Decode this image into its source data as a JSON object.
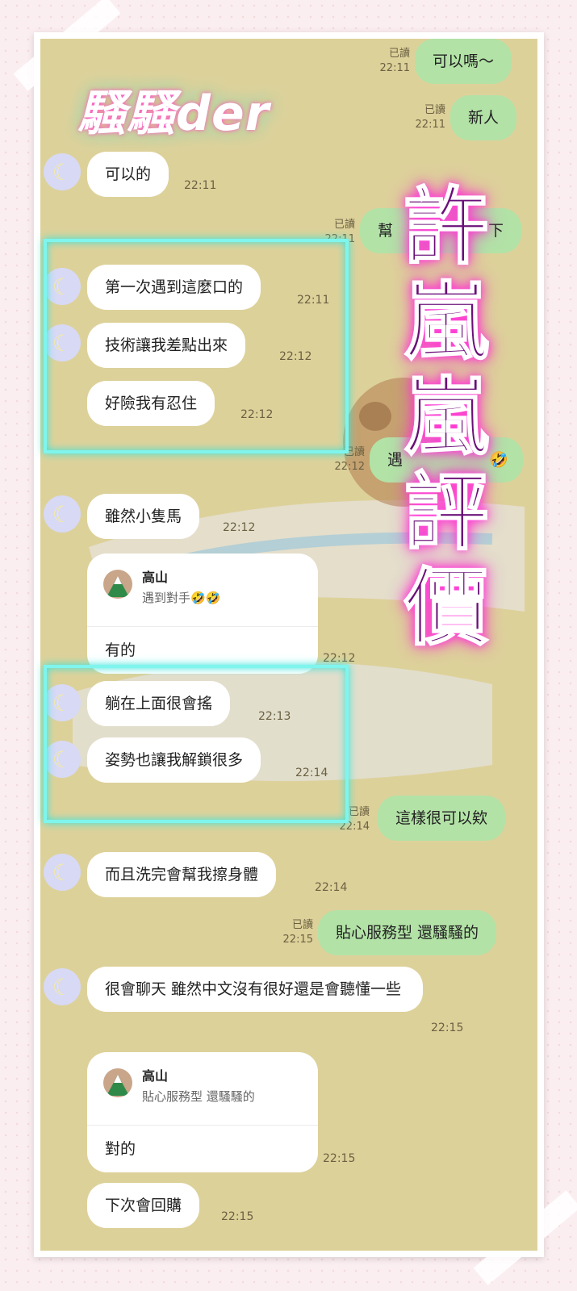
{
  "logo": "騷騷der",
  "title_chars": [
    "許",
    "嵐",
    "嵐",
    "評",
    "價"
  ],
  "colors": {
    "chat_bg": "#ddd19a",
    "my_bubble": "#b2e2a6",
    "glow": "#7ff5ee",
    "title": "#6a0f78"
  },
  "avatar_icon": "moon-icon",
  "messages": {
    "m1": {
      "text": "可以嗎～",
      "read": "已讀",
      "time": "22:11"
    },
    "m2": {
      "text": "新人",
      "read": "已讀",
      "time": "22:11"
    },
    "m3": {
      "text": "可以的",
      "time": "22:11"
    },
    "m4": {
      "text": "幫",
      "text_end": "下",
      "read": "已讀",
      "time": "22:11"
    },
    "m5": {
      "text": "第一次遇到這麼口的",
      "time": "22:11"
    },
    "m6": {
      "text": "技術讓我差點出來",
      "time": "22:12"
    },
    "m7": {
      "text": "好險我有忍住",
      "time": "22:12"
    },
    "m8": {
      "text": "遇",
      "emoji": "🤣",
      "read": "已讀",
      "time": "22:12"
    },
    "m9": {
      "text": "雖然小隻馬",
      "time": "22:12"
    },
    "m10": {
      "quote_name": "高山",
      "quote_text": "遇到對手🤣🤣",
      "text": "有的",
      "time": "22:12"
    },
    "m11": {
      "text": "躺在上面很會搖",
      "time": "22:13"
    },
    "m12": {
      "text": "姿勢也讓我解鎖很多",
      "time": "22:14"
    },
    "m13": {
      "text": "這樣很可以欸",
      "read": "已讀",
      "time": "22:14"
    },
    "m14": {
      "text": "而且洗完會幫我擦身體",
      "time": "22:14"
    },
    "m15": {
      "text": "貼心服務型 還騷騷的",
      "read": "已讀",
      "time": "22:15"
    },
    "m16": {
      "text": "很會聊天 雖然中文沒有很好還是會聽懂一些",
      "time": "22:15"
    },
    "m17": {
      "quote_name": "高山",
      "quote_text": "貼心服務型 還騷騷的",
      "text": "對的",
      "time": "22:15"
    },
    "m18": {
      "text": "下次會回購",
      "time": "22:15"
    }
  }
}
